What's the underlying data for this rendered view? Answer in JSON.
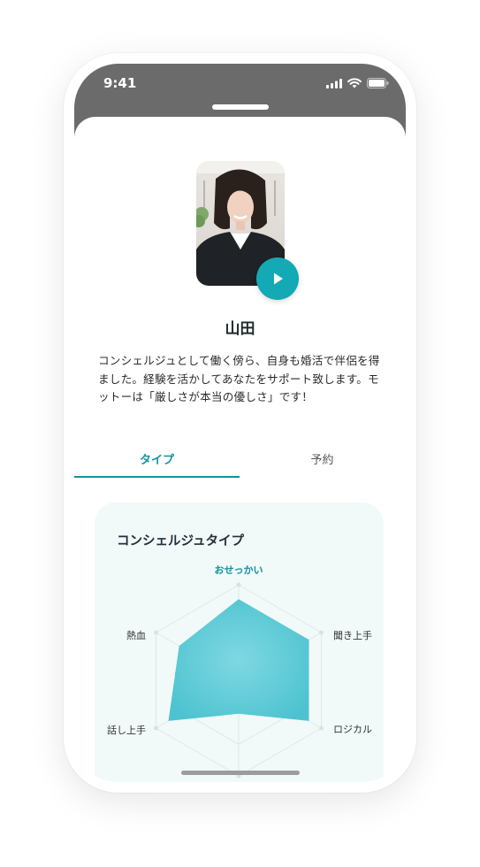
{
  "status_bar": {
    "time": "9:41"
  },
  "profile": {
    "name": "山田",
    "bio": "コンシェルジュとして働く傍ら、自身も婚活で伴侶を得ました。経験を活かしてあなたをサポート致します。モットーは「厳しさが本当の優しさ」です！",
    "video_button_icon": "play-icon"
  },
  "tabs": [
    {
      "label": "タイプ",
      "active": true
    },
    {
      "label": "予約",
      "active": false
    }
  ],
  "type_card": {
    "title": "コンシェルジュタイプ",
    "axes": [
      "おせっかい",
      "聞き上手",
      "ロジカル",
      "",
      "話し上手",
      "熱血"
    ],
    "values": [
      0.85,
      0.85,
      0.85,
      0.35,
      0.85,
      0.72
    ]
  },
  "colors": {
    "accent": "#13929c",
    "play": "#13a9b5",
    "radar_fill": "#55c7d3"
  }
}
